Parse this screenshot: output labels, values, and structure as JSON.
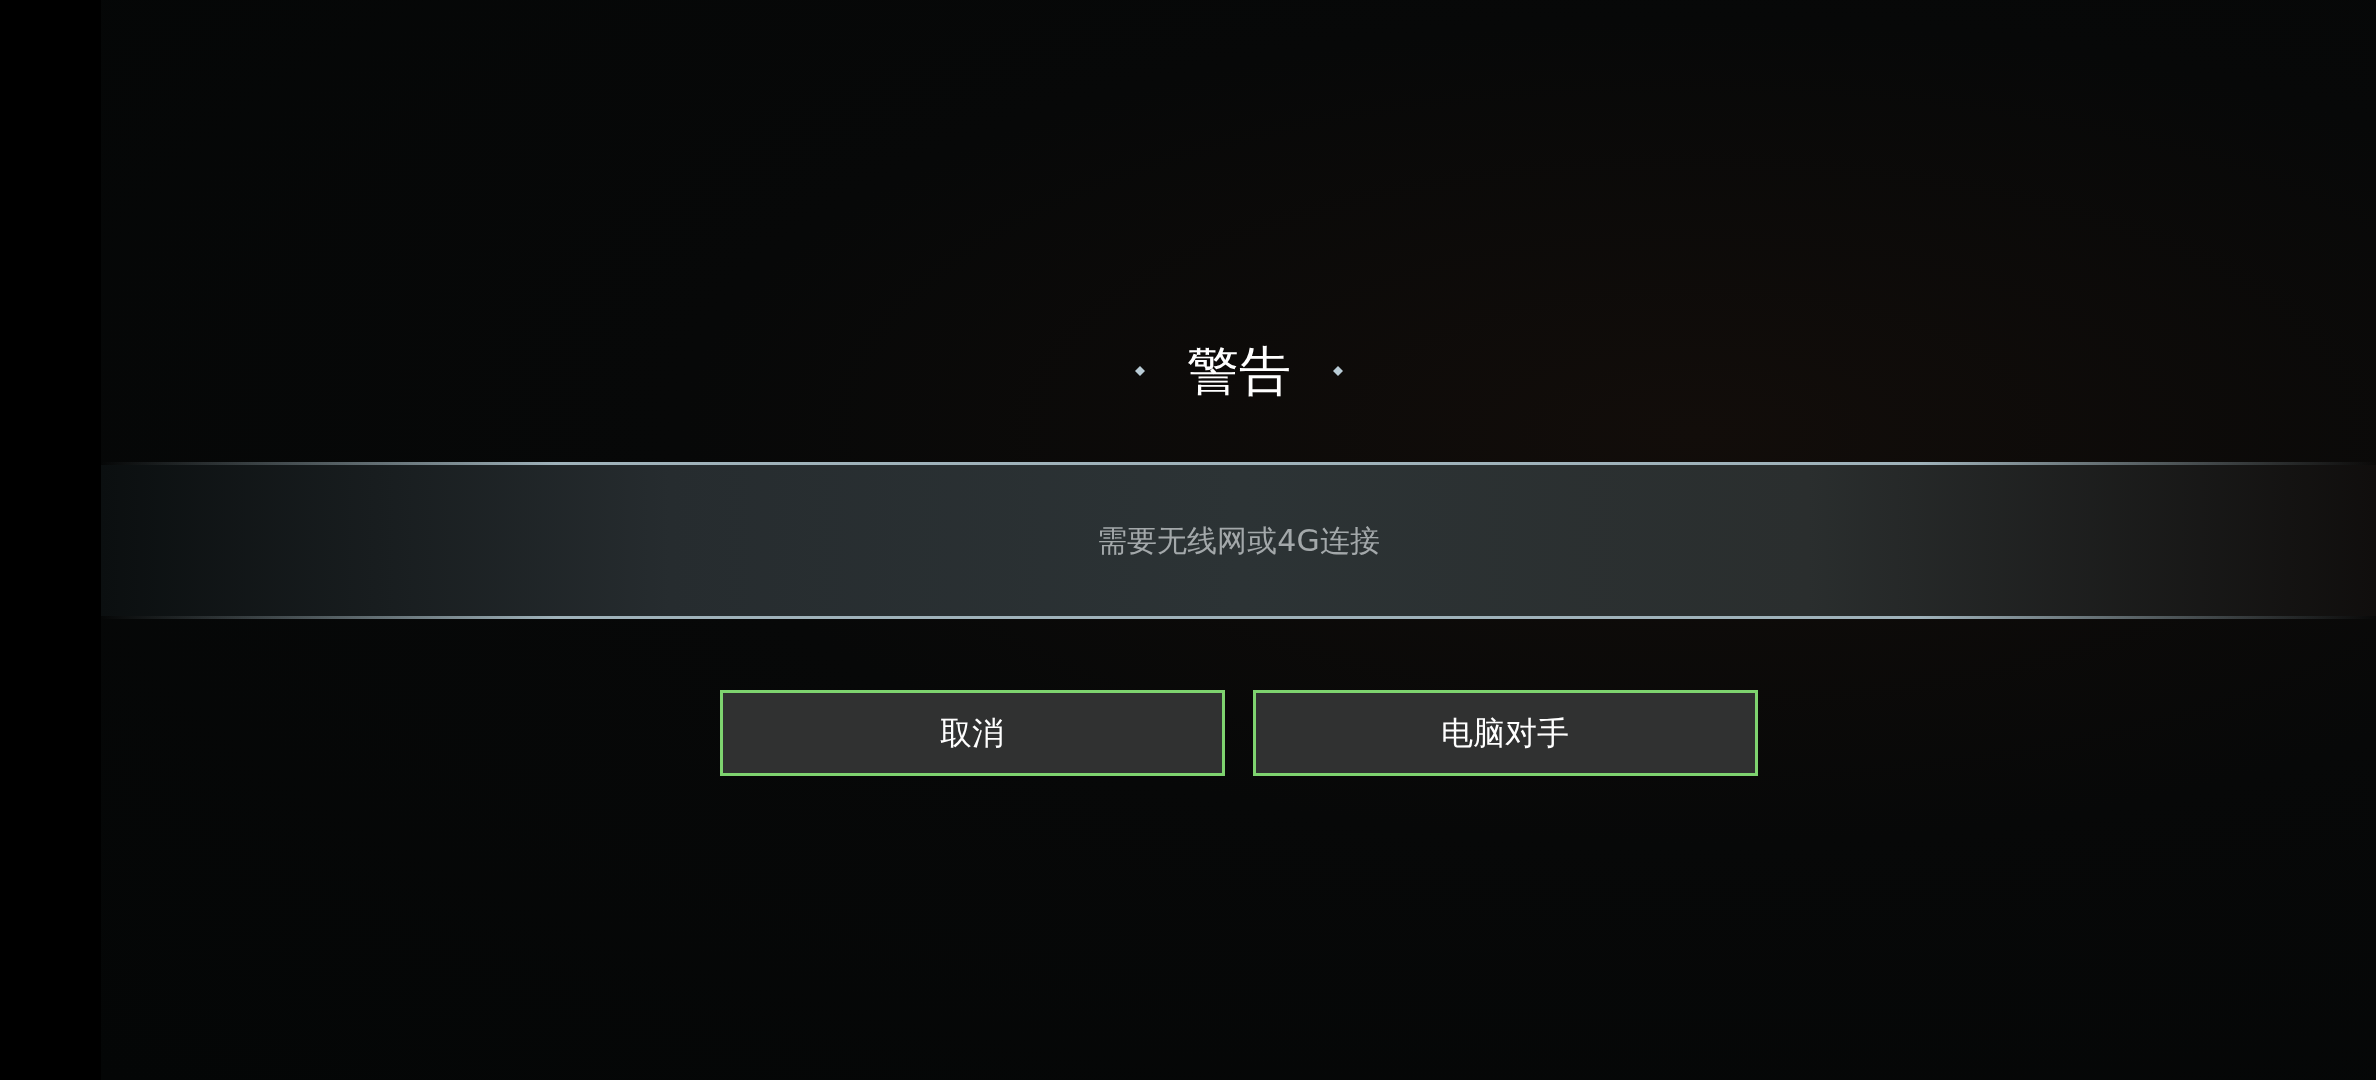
{
  "dialog": {
    "title": "警告",
    "message": "需要无线网或4G连接",
    "buttons": [
      {
        "label": "取消"
      },
      {
        "label": "电脑对手"
      }
    ]
  }
}
